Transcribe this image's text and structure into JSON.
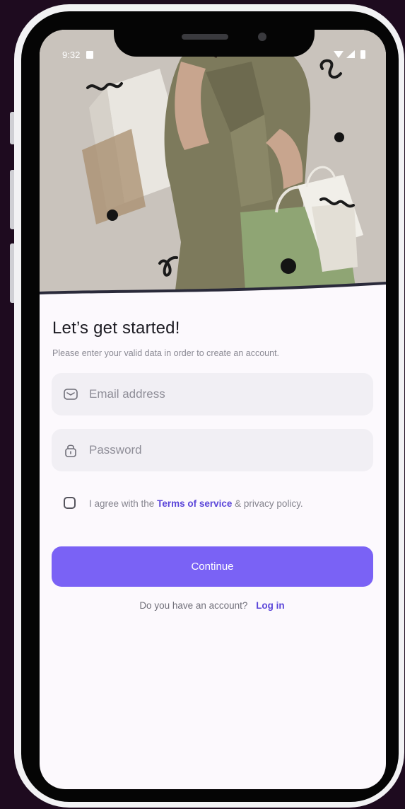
{
  "status_bar": {
    "time": "9:32",
    "icons": [
      "sd-card-icon",
      "wifi-icon",
      "signal-icon",
      "battery-icon"
    ]
  },
  "hero": {
    "description_icon": "shopping-woman-photo"
  },
  "signup": {
    "title": "Let’s get started!",
    "subtitle": "Please enter your valid data in order to create an account.",
    "email": {
      "placeholder": "Email address",
      "icon": "mail-icon"
    },
    "password": {
      "placeholder": "Password",
      "icon": "lock-icon"
    },
    "agree": {
      "prefix": "I agree with the",
      "terms_link": "Terms of service",
      "suffix": "& privacy policy.",
      "checked": false
    },
    "continue_label": "Continue",
    "login_prompt": "Do you have an account?",
    "login_link": "Log in"
  },
  "colors": {
    "accent": "#7a62f5",
    "link": "#5b46d9",
    "background": "#1e0b1f",
    "field": "#f1eff4"
  }
}
